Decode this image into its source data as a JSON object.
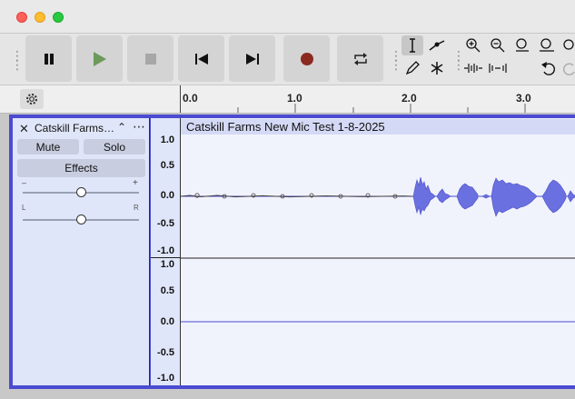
{
  "toolbar": {
    "pause_label": "Pause",
    "play_label": "Play",
    "stop_label": "Stop",
    "skip_start_label": "Skip to Start",
    "skip_end_label": "Skip to End",
    "record_label": "Record",
    "loop_label": "Loop"
  },
  "ruler": {
    "labels": [
      "0.0",
      "1.0",
      "2.0",
      "3.0"
    ]
  },
  "track": {
    "name": "Catskill Farms…",
    "mute_label": "Mute",
    "solo_label": "Solo",
    "effects_label": "Effects",
    "gain_min": "–",
    "gain_max": "+",
    "pan_left": "L",
    "pan_right": "R",
    "gain_level": 0.5,
    "pan_level": 0.5
  },
  "vertical_ruler": {
    "channel1": [
      "1.0",
      "0.5",
      "0.0",
      "-0.5",
      "-1.0"
    ],
    "channel2": [
      "1.0",
      "0.5",
      "0.0",
      "-0.5",
      "-1.0"
    ]
  },
  "clip": {
    "title": "Catskill Farms New Mic Test 1-8-2025"
  },
  "colors": {
    "accent": "#4b4bd1",
    "waveform": "#6a70e0",
    "clip_bg": "#f1f3fc",
    "record": "#8b2a1f",
    "play": "#6d9a5c"
  }
}
